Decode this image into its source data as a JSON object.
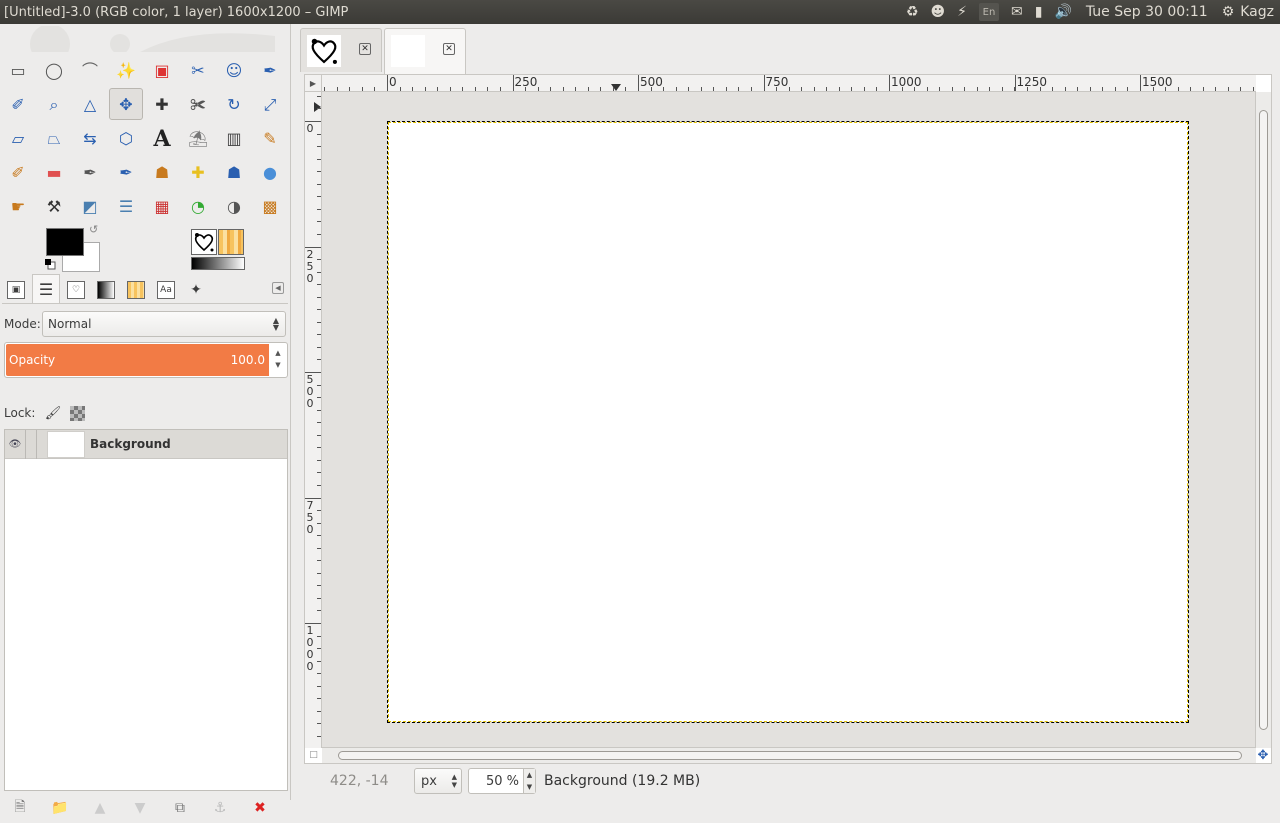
{
  "window": {
    "title": "[Untitled]-3.0 (RGB color, 1 layer) 1600x1200 – GIMP"
  },
  "panel": {
    "keyboard_layout": "En",
    "clock": "Tue Sep 30 00:11",
    "user": "Kagz"
  },
  "toolbox": {
    "tools": [
      "rect-select-icon",
      "ellipse-select-icon",
      "free-select-icon",
      "fuzzy-select-icon",
      "select-by-color-icon",
      "scissors-select-icon",
      "foreground-select-icon",
      "paths-icon",
      "color-picker-icon",
      "zoom-icon",
      "measure-icon",
      "move-icon",
      "align-icon",
      "crop-icon",
      "rotate-icon",
      "scale-icon",
      "shear-icon",
      "perspective-icon",
      "flip-icon",
      "cage-transform-icon",
      "text-icon",
      "bucket-fill-icon",
      "blend-icon",
      "pencil-icon",
      "paintbrush-icon",
      "eraser-icon",
      "airbrush-icon",
      "ink-icon",
      "clone-icon",
      "heal-icon",
      "perspective-clone-icon",
      "blur-icon",
      "smudge-icon",
      "dodge-burn-icon",
      "desaturate-icon",
      "levels-icon",
      "hue-saturation-icon",
      "color-balance-icon",
      "threshold-icon",
      "curves-icon"
    ],
    "fg_color": "#000000",
    "bg_color": "#ffffff"
  },
  "layers": {
    "mode_label": "Mode:",
    "mode_value": "Normal",
    "opacity_label": "Opacity",
    "opacity_value": "100.0",
    "opacity_fraction": 1.0,
    "lock_label": "Lock:",
    "items": [
      {
        "name": "Background",
        "visible": true
      }
    ],
    "accent_color": "#f27b45"
  },
  "image_window": {
    "h_ruler_labels": [
      "0",
      "250",
      "500",
      "750",
      "1000",
      "1250",
      "1500"
    ],
    "v_ruler_labels": [
      [
        "0"
      ],
      [
        "2",
        "5",
        "0"
      ],
      [
        "5",
        "0",
        "0"
      ],
      [
        "7",
        "5",
        "0"
      ],
      [
        "1",
        "0",
        "0",
        "0"
      ]
    ],
    "pointer_coords": "422, -14",
    "unit": "px",
    "zoom": "50 %",
    "status_text": "Background (19.2 MB)"
  }
}
